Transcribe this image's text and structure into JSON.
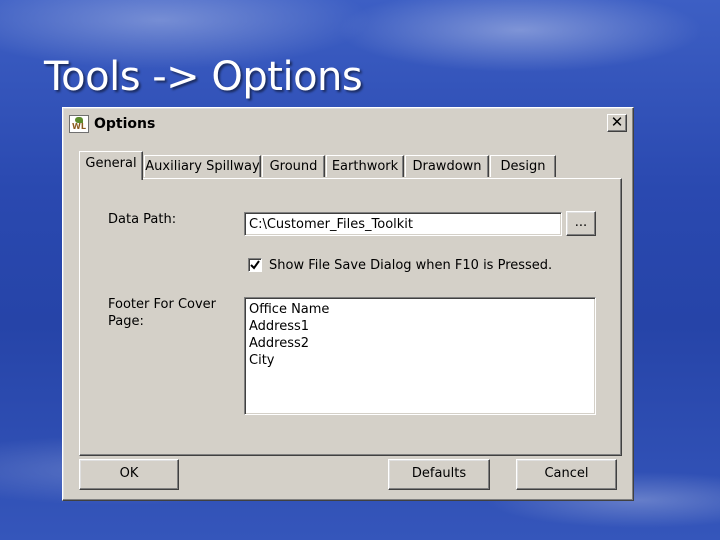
{
  "slide": {
    "title": "Tools -> Options"
  },
  "dialog": {
    "title": "Options",
    "close_glyph": "✕",
    "tabs": [
      {
        "label": "General",
        "active": true
      },
      {
        "label": "Auxiliary Spillway",
        "active": false
      },
      {
        "label": "Ground",
        "active": false
      },
      {
        "label": "Earthwork",
        "active": false
      },
      {
        "label": "Drawdown",
        "active": false
      },
      {
        "label": "Design",
        "active": false
      }
    ],
    "general": {
      "data_path_label": "Data Path:",
      "data_path_value": "C:\\Customer_Files_Toolkit",
      "browse_label": "...",
      "show_save_dialog_checked": true,
      "show_save_dialog_label": "Show File Save Dialog when F10 is Pressed.",
      "footer_label_line1": "Footer For Cover",
      "footer_label_line2": "Page:",
      "footer_lines": [
        "Office Name",
        "Address1",
        "Address2",
        "City"
      ]
    },
    "buttons": {
      "ok": "OK",
      "defaults": "Defaults",
      "cancel": "Cancel"
    }
  },
  "icons": {
    "app": "wl-app-icon",
    "close": "close-icon",
    "check": "checkmark-icon"
  }
}
